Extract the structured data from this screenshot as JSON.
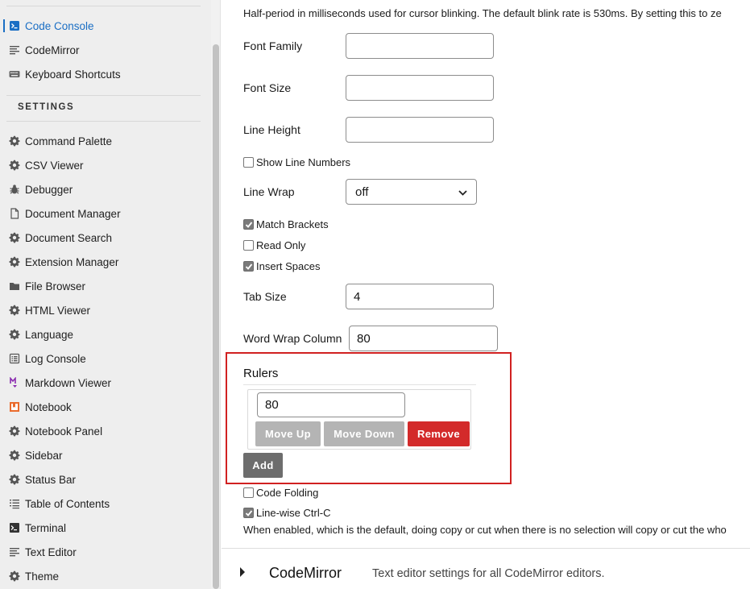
{
  "sidebar": {
    "top_items": [
      {
        "label": "Code Console",
        "icon": "code-console-icon",
        "active": true
      },
      {
        "label": "CodeMirror",
        "icon": "text-lines-icon",
        "active": false
      },
      {
        "label": "Keyboard Shortcuts",
        "icon": "keyboard-icon",
        "active": false
      }
    ],
    "settings_heading": "SETTINGS",
    "settings_items": [
      {
        "label": "Command Palette",
        "icon": "gear-icon"
      },
      {
        "label": "CSV Viewer",
        "icon": "gear-icon"
      },
      {
        "label": "Debugger",
        "icon": "bug-icon"
      },
      {
        "label": "Document Manager",
        "icon": "document-icon"
      },
      {
        "label": "Document Search",
        "icon": "gear-icon"
      },
      {
        "label": "Extension Manager",
        "icon": "gear-icon"
      },
      {
        "label": "File Browser",
        "icon": "folder-icon"
      },
      {
        "label": "HTML Viewer",
        "icon": "gear-icon"
      },
      {
        "label": "Language",
        "icon": "gear-icon"
      },
      {
        "label": "Log Console",
        "icon": "list-icon"
      },
      {
        "label": "Markdown Viewer",
        "icon": "markdown-icon"
      },
      {
        "label": "Notebook",
        "icon": "notebook-icon"
      },
      {
        "label": "Notebook Panel",
        "icon": "gear-icon"
      },
      {
        "label": "Sidebar",
        "icon": "gear-icon"
      },
      {
        "label": "Status Bar",
        "icon": "gear-icon"
      },
      {
        "label": "Table of Contents",
        "icon": "toc-icon"
      },
      {
        "label": "Terminal",
        "icon": "terminal-icon"
      },
      {
        "label": "Text Editor",
        "icon": "text-lines-icon"
      },
      {
        "label": "Theme",
        "icon": "gear-icon"
      }
    ]
  },
  "form": {
    "cursor_blink_desc": "Half-period in milliseconds used for cursor blinking. The default blink rate is 530ms. By setting this to ze",
    "font_family": {
      "label": "Font Family",
      "value": ""
    },
    "font_size": {
      "label": "Font Size",
      "value": ""
    },
    "line_height": {
      "label": "Line Height",
      "value": ""
    },
    "show_line_numbers": {
      "label": "Show Line Numbers",
      "checked": false
    },
    "line_wrap": {
      "label": "Line Wrap",
      "value": "off"
    },
    "match_brackets": {
      "label": "Match Brackets",
      "checked": true
    },
    "read_only": {
      "label": "Read Only",
      "checked": false
    },
    "insert_spaces": {
      "label": "Insert Spaces",
      "checked": true
    },
    "tab_size": {
      "label": "Tab Size",
      "value": "4"
    },
    "word_wrap_column": {
      "label": "Word Wrap Column",
      "value": "80"
    },
    "rulers": {
      "title": "Rulers",
      "items": [
        "80"
      ],
      "move_up_label": "Move Up",
      "move_down_label": "Move Down",
      "remove_label": "Remove",
      "add_label": "Add"
    },
    "code_folding": {
      "label": "Code Folding",
      "checked": false
    },
    "linewise_copy": {
      "label": "Line-wise Ctrl-C",
      "checked": true
    },
    "linewise_desc": "When enabled, which is the default, doing copy or cut when there is no selection will copy or cut the who"
  },
  "next_section": {
    "title": "CodeMirror",
    "description": "Text editor settings for all CodeMirror editors."
  },
  "colors": {
    "accent": "#1a6ec4",
    "remove": "#d32a2a",
    "highlight": "#d12121"
  }
}
